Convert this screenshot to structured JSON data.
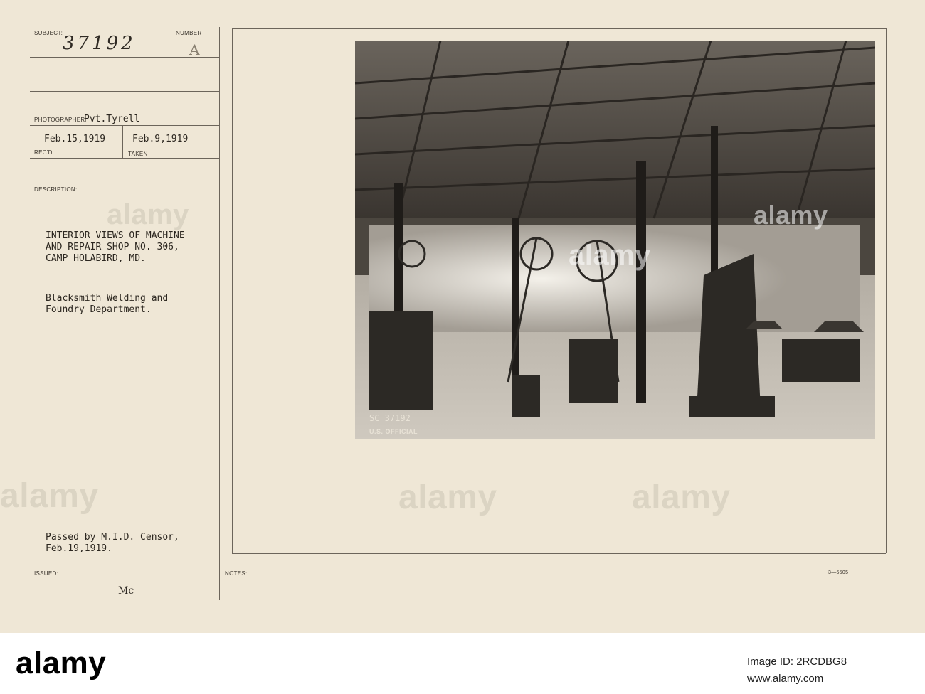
{
  "card": {
    "labels": {
      "subject": "SUBJECT:",
      "number": "NUMBER",
      "photographer": "PHOTOGRAPHER",
      "recd": "REC'D",
      "taken": "TAKEN",
      "description": "DESCRIPTION:",
      "issued": "ISSUED:",
      "notes": "NOTES:"
    },
    "subject_number": "37192",
    "letter": "A",
    "photographer_name": "Pvt.Tyrell",
    "date_received": "Feb.15,1919",
    "date_taken": "Feb.9,1919",
    "description_lines": [
      "INTERIOR VIEWS OF MACHINE",
      "AND REPAIR SHOP NO. 306,",
      "CAMP HOLABIRD, MD."
    ],
    "department_lines": [
      "Blacksmith Welding and",
      "Foundry Department."
    ],
    "censor_lines": [
      "Passed by M.I.D. Censor,",
      "Feb.19,1919."
    ],
    "issued_initials": "Mc",
    "form_number": "3—5505"
  },
  "photo": {
    "negative_number": "SC 37192",
    "stamp": "U.S. OFFICIAL"
  },
  "watermarks": {
    "text": "alamy"
  },
  "footer": {
    "logo": "alamy",
    "image_id": "Image ID: 2RCDBG8",
    "url": "www.alamy.com"
  }
}
